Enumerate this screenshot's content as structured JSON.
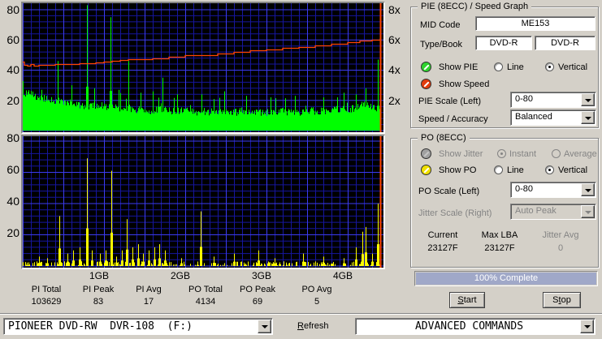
{
  "colors": {
    "window_bg": "#d4d0c8",
    "progress_fill": "#a0a8c8",
    "led_pie": "#2ed32e",
    "led_speed": "#e23c0e",
    "led_po": "#f0e000",
    "led_disabled": "#a0a0a0"
  },
  "chart_data": [
    {
      "name": "pie_speed_graph",
      "type": "bar+line",
      "x_unit": "GB",
      "x_max_gb": 4.44,
      "marker_gb": 4.4,
      "x_ticks": [
        "1GB",
        "2GB",
        "3GB",
        "4GB"
      ],
      "left_axis": {
        "label": "PIE",
        "range": [
          0,
          80
        ],
        "ticks": [
          "80",
          "60",
          "40",
          "20"
        ]
      },
      "right_axis": {
        "label": "Speed",
        "range_x": [
          0,
          8
        ],
        "ticks": [
          "8x",
          "6x",
          "4x",
          "2x"
        ]
      },
      "pie_base": [
        [
          0,
          25
        ],
        [
          0.1,
          24
        ],
        [
          0.2,
          22
        ],
        [
          0.3,
          21
        ],
        [
          0.4,
          20
        ],
        [
          0.5,
          19
        ],
        [
          0.6,
          18
        ],
        [
          0.7,
          17
        ],
        [
          0.8,
          16
        ],
        [
          0.9,
          17
        ],
        [
          1.0,
          16
        ],
        [
          1.1,
          15
        ],
        [
          1.2,
          15
        ],
        [
          1.3,
          15
        ],
        [
          1.4,
          14
        ],
        [
          1.5,
          14
        ],
        [
          1.6,
          13
        ],
        [
          1.7,
          14
        ],
        [
          1.8,
          13
        ],
        [
          1.9,
          13
        ],
        [
          2.0,
          13
        ],
        [
          2.1,
          12
        ],
        [
          2.2,
          13
        ],
        [
          2.3,
          12
        ],
        [
          2.4,
          13
        ],
        [
          2.5,
          12
        ],
        [
          2.6,
          12
        ],
        [
          2.7,
          13
        ],
        [
          2.8,
          12
        ],
        [
          2.9,
          12
        ],
        [
          3.0,
          12
        ],
        [
          3.1,
          12
        ],
        [
          3.2,
          13
        ],
        [
          3.3,
          12
        ],
        [
          3.4,
          12
        ],
        [
          3.5,
          13
        ],
        [
          3.6,
          13
        ],
        [
          3.7,
          13
        ],
        [
          3.8,
          14
        ],
        [
          3.9,
          14
        ],
        [
          4.0,
          14
        ],
        [
          4.1,
          15
        ],
        [
          4.2,
          18
        ],
        [
          4.3,
          15
        ],
        [
          4.4,
          13
        ]
      ],
      "pie_spikes": [
        [
          0.43,
          46
        ],
        [
          0.6,
          30
        ],
        [
          0.79,
          83
        ],
        [
          0.88,
          28
        ],
        [
          1.08,
          75
        ],
        [
          1.18,
          27
        ],
        [
          1.3,
          46
        ],
        [
          1.45,
          25
        ],
        [
          1.6,
          26
        ],
        [
          1.72,
          35
        ],
        [
          1.9,
          24
        ],
        [
          2.2,
          24
        ],
        [
          2.48,
          26
        ],
        [
          2.75,
          23
        ],
        [
          3.05,
          22
        ],
        [
          3.35,
          23
        ],
        [
          3.7,
          22
        ],
        [
          3.95,
          25
        ],
        [
          4.1,
          24
        ],
        [
          4.22,
          28
        ],
        [
          4.37,
          47
        ]
      ],
      "noise_amp": 2.5,
      "noise_seed": 20240601,
      "speed_line_x": [
        [
          0,
          4.55
        ],
        [
          0.02,
          4.35
        ],
        [
          0.06,
          4.3
        ],
        [
          0.1,
          4.38
        ],
        [
          0.14,
          4.32
        ],
        [
          0.2,
          4.36
        ],
        [
          0.3,
          4.33
        ],
        [
          0.4,
          4.38
        ],
        [
          0.5,
          4.42
        ],
        [
          0.6,
          4.4
        ],
        [
          0.7,
          4.45
        ],
        [
          0.8,
          4.47
        ],
        [
          0.9,
          4.5
        ],
        [
          1.0,
          4.55
        ],
        [
          1.1,
          4.62
        ],
        [
          1.2,
          4.65
        ],
        [
          1.3,
          4.72
        ],
        [
          1.45,
          4.75
        ],
        [
          1.6,
          4.78
        ],
        [
          1.8,
          4.88
        ],
        [
          2.0,
          4.97
        ],
        [
          2.2,
          5.02
        ],
        [
          2.4,
          5.12
        ],
        [
          2.6,
          5.2
        ],
        [
          2.8,
          5.3
        ],
        [
          3.0,
          5.38
        ],
        [
          3.2,
          5.45
        ],
        [
          3.4,
          5.55
        ],
        [
          3.6,
          5.65
        ],
        [
          3.8,
          5.75
        ],
        [
          4.0,
          5.85
        ],
        [
          4.15,
          5.95
        ],
        [
          4.3,
          6.02
        ],
        [
          4.4,
          6.1
        ]
      ],
      "colors": {
        "bars": "#00ff00",
        "line": "#ff4500",
        "marker": "#ff4500",
        "bg": "#000000",
        "grid_minor": "#16169e",
        "grid_major": "#3c3cf0"
      }
    },
    {
      "name": "po_graph",
      "type": "bar",
      "x_unit": "GB",
      "x_max_gb": 4.44,
      "marker_gb": 4.4,
      "left_axis": {
        "label": "PO",
        "range": [
          0,
          80
        ],
        "ticks": [
          "80",
          "60",
          "40",
          "20"
        ]
      },
      "po_spikes": [
        [
          0.2,
          6
        ],
        [
          0.3,
          5
        ],
        [
          0.45,
          32
        ],
        [
          0.55,
          8
        ],
        [
          0.62,
          10
        ],
        [
          0.7,
          12
        ],
        [
          0.79,
          69
        ],
        [
          0.85,
          10
        ],
        [
          0.95,
          8
        ],
        [
          1.02,
          10
        ],
        [
          1.09,
          61
        ],
        [
          1.15,
          6
        ],
        [
          1.22,
          10
        ],
        [
          1.28,
          30
        ],
        [
          1.35,
          12
        ],
        [
          1.42,
          14
        ],
        [
          1.48,
          8
        ],
        [
          1.55,
          10
        ],
        [
          1.62,
          12
        ],
        [
          1.68,
          14
        ],
        [
          1.75,
          10
        ],
        [
          1.95,
          5
        ],
        [
          2.19,
          35
        ],
        [
          2.35,
          6
        ],
        [
          2.6,
          8
        ],
        [
          2.9,
          10
        ],
        [
          3.1,
          5
        ],
        [
          3.45,
          8
        ],
        [
          3.7,
          6
        ],
        [
          3.95,
          5
        ],
        [
          4.1,
          12
        ],
        [
          4.18,
          22
        ],
        [
          4.22,
          25
        ],
        [
          4.3,
          8
        ],
        [
          4.37,
          40
        ]
      ],
      "small_bar_prob": 0.42,
      "small_bar_max": 3,
      "noise_seed": 99,
      "colors": {
        "bars": "#ffff00",
        "marker": "#ff4500",
        "bg": "#000000",
        "grid_minor": "#16169e",
        "grid_major": "#3c3cf0"
      }
    }
  ],
  "pie_panel": {
    "title": "PIE (8ECC) / Speed Graph",
    "mid_code_label": "MID Code",
    "mid_code_value": "ME153",
    "type_book_label": "Type/Book",
    "type_value": "DVD-R",
    "book_value": "DVD-R",
    "show_pie_label": "Show PIE",
    "line_label": "Line",
    "vertical_label": "Vertical",
    "show_speed_label": "Show Speed",
    "pie_scale_label": "PIE Scale (Left)",
    "pie_scale_value": "0-80",
    "speed_accuracy_label": "Speed / Accuracy",
    "speed_accuracy_value": "Balanced"
  },
  "po_panel": {
    "title": "PO (8ECC)",
    "show_jitter_label": "Show Jitter",
    "instant_label": "Instant",
    "average_label": "Average",
    "show_po_label": "Show PO",
    "line_label": "Line",
    "vertical_label": "Vertical",
    "po_scale_label": "PO Scale (Left)",
    "po_scale_value": "0-80",
    "jitter_scale_label": "Jitter Scale (Right)",
    "jitter_scale_value": "Auto Peak",
    "current_label": "Current",
    "current_value": "23127F",
    "max_lba_label": "Max LBA",
    "max_lba_value": "23127F",
    "jitter_avg_label": "Jitter Avg",
    "jitter_avg_value": "0"
  },
  "progress": {
    "percent": 100,
    "text": "100% Complete"
  },
  "buttons": {
    "start": {
      "pre": "",
      "accel": "S",
      "rest": "tart"
    },
    "stop": {
      "pre": "S",
      "accel": "t",
      "rest": "op"
    }
  },
  "stats": {
    "items": [
      {
        "label": "PI Total",
        "value": "103629"
      },
      {
        "label": "PI Peak",
        "value": "83"
      },
      {
        "label": "PI Avg",
        "value": "17"
      },
      {
        "label": "PO Total",
        "value": "4134"
      },
      {
        "label": "PO Peak",
        "value": "69"
      },
      {
        "label": "PO Avg",
        "value": "5"
      }
    ]
  },
  "bottom_bar": {
    "drive_value": "PIONEER DVD-RW  DVR-108  (F:)",
    "refresh": {
      "pre": "",
      "accel": "R",
      "rest": "efresh"
    },
    "commands_value": "ADVANCED COMMANDS"
  }
}
